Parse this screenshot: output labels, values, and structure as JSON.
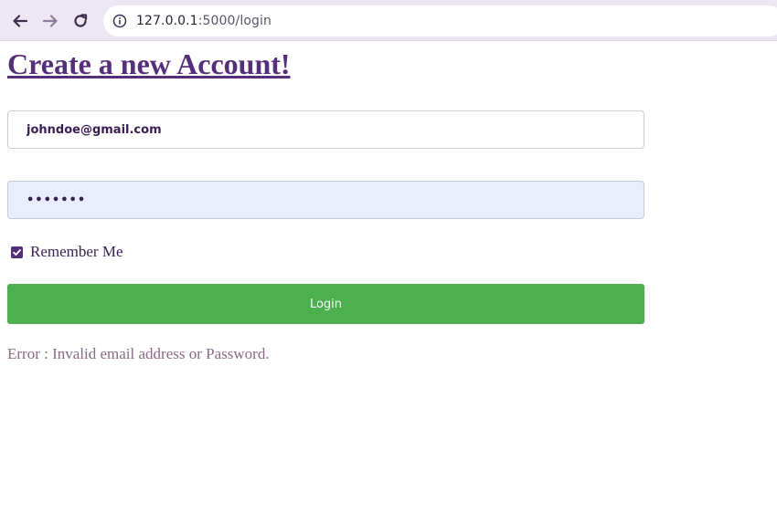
{
  "browser": {
    "url_host": "127.0.0.1",
    "url_rest": ":5000/login",
    "icons": {
      "back": "back-arrow-icon",
      "forward": "forward-arrow-icon",
      "reload": "reload-icon",
      "site_info": "info-icon"
    }
  },
  "page": {
    "title": "Create a new Account!",
    "email_value": "johndoe@gmail.com",
    "password_value": "•••••••",
    "remember_label": "Remember Me",
    "remember_checked": true,
    "login_label": "Login",
    "error_message": "Error : Invalid email address or Password."
  },
  "colors": {
    "accent": "#55307a",
    "button": "#4caf50",
    "autofill_bg": "#e8eefb",
    "error_text": "#8a6a86"
  }
}
